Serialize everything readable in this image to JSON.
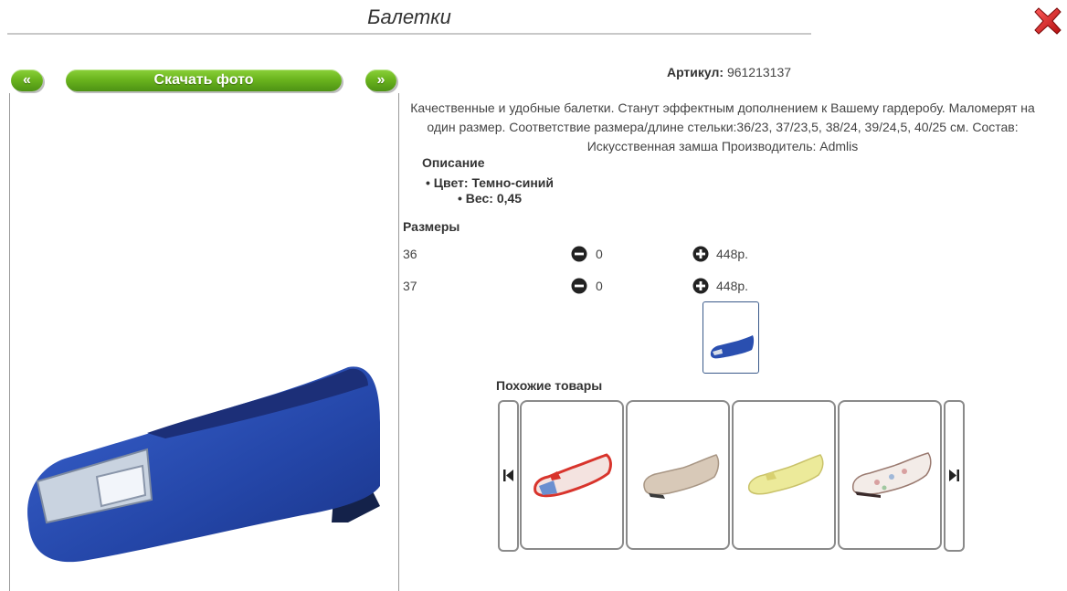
{
  "header": {
    "title": "Балетки",
    "close_icon": "close-icon"
  },
  "gallery": {
    "prev_label": "«",
    "download_label": "Скачать фото",
    "next_label": "»"
  },
  "product": {
    "article_label": "Артикул:",
    "article_value": "961213137",
    "description": "Качественные и удобные балетки. Станут эффектным дополнением к Вашему гардеробу. Маломерят на один размер. Соответствие размера/длине стельки:36/23, 37/23,5, 38/24, 39/24,5, 40/25 см. Состав: Искусственная замша Производитель: Admlis",
    "details_title": "Описание",
    "color": "Цвет: Темно-синий",
    "weight": "Вес: 0,45"
  },
  "sizes": {
    "title": "Размеры",
    "rows": [
      {
        "size": "36",
        "qty": "0",
        "price": "448р."
      },
      {
        "size": "37",
        "qty": "0",
        "price": "448р."
      }
    ]
  },
  "similar": {
    "title": "Похожие товары",
    "count": 4
  },
  "colors": {
    "accent_green": "#6bb51e",
    "close_red": "#d42020",
    "shoe_blue": "#2a4fb0"
  }
}
